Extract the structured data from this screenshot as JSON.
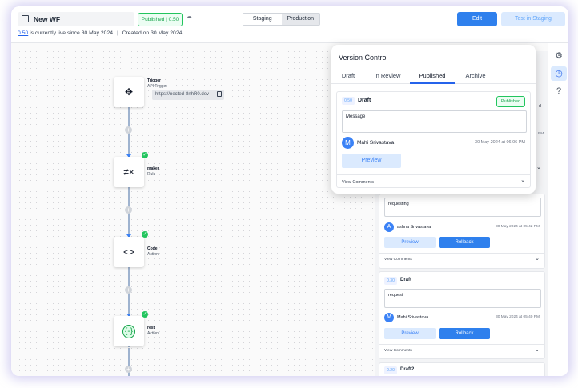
{
  "header": {
    "workflow_name": "New WF",
    "published_badge": "Published | 0.50",
    "env_tabs": [
      "Staging",
      "Production"
    ],
    "edit_label": "Edit",
    "test_label": "Test in Staging",
    "live_version": "0.50",
    "live_text": "is currently live since 30 May 2024",
    "separator": "|",
    "created_text": "Created on 30 May 2024"
  },
  "canvas": {
    "nodes": [
      {
        "title": "Trigger",
        "subtitle": "API Trigger",
        "icon": "move-arrows-icon",
        "glyph": "✥"
      },
      {
        "title": "maker",
        "subtitle": "Rule",
        "icon": "rule-icon",
        "glyph": "≠×"
      },
      {
        "title": "Code",
        "subtitle": "Action",
        "icon": "code-icon",
        "glyph": "<>"
      },
      {
        "title": "rest",
        "subtitle": "Action",
        "icon": "rest-braces-icon",
        "glyph": "{-}"
      }
    ],
    "url": "https://nected-8nhR0.dev",
    "plus": "+",
    "check": "✓"
  },
  "sidebar": {
    "icons": [
      "settings-icon",
      "version-history-icon",
      "help-icon"
    ],
    "glyphs": [
      "⚙",
      "◷",
      "?"
    ]
  },
  "version_control": {
    "title": "Version Control",
    "tabs": [
      "Draft",
      "In Review",
      "Published",
      "Archive"
    ],
    "active_tab": "Published",
    "card": {
      "version": "0.50",
      "status": "Draft",
      "badge": "Published",
      "message": "Message",
      "author_initial": "M",
      "author": "Mahi Srivastava",
      "date": "30 May 2024 at 06:06 PM",
      "preview_label": "Preview",
      "comments_label": "View Comments"
    }
  },
  "version_list": [
    {
      "message": "requesting",
      "author_initial": "A",
      "author": "ashna Srivastava",
      "date": "30 May 2024 at 05:42 PM",
      "preview_label": "Preview",
      "rollback_label": "Rollback",
      "comments_label": "View Comments"
    },
    {
      "version": "0.30",
      "status": "Draft",
      "message": "request",
      "author_initial": "M",
      "author": "Mahi Srivastava",
      "date": "30 May 2024 at 05:40 PM",
      "preview_label": "Preview",
      "rollback_label": "Rollback",
      "comments_label": "View Comments"
    },
    {
      "version": "0.20",
      "status": "Draft2"
    }
  ],
  "partial_text": {
    "date_fragment": "PM",
    "d_fragment": "d"
  },
  "colors": {
    "primary": "#2f80ed",
    "success": "#22c55e",
    "frame_glow": "#b0aae8"
  }
}
